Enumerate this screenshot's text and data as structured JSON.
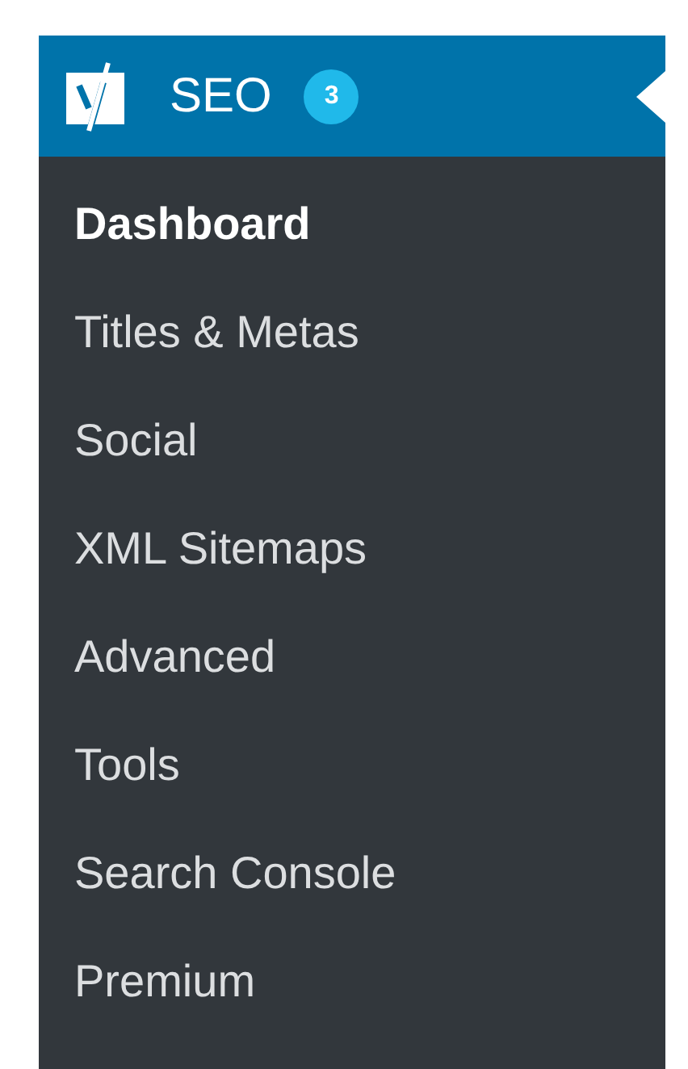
{
  "menu": {
    "title": "SEO",
    "badge": "3",
    "expanded": true
  },
  "items": [
    {
      "label": "Dashboard",
      "selected": true
    },
    {
      "label": "Titles & Metas",
      "selected": false
    },
    {
      "label": "Social",
      "selected": false
    },
    {
      "label": "XML Sitemaps",
      "selected": false
    },
    {
      "label": "Advanced",
      "selected": false
    },
    {
      "label": "Tools",
      "selected": false
    },
    {
      "label": "Search Console",
      "selected": false
    },
    {
      "label": "Premium",
      "selected": false
    }
  ]
}
